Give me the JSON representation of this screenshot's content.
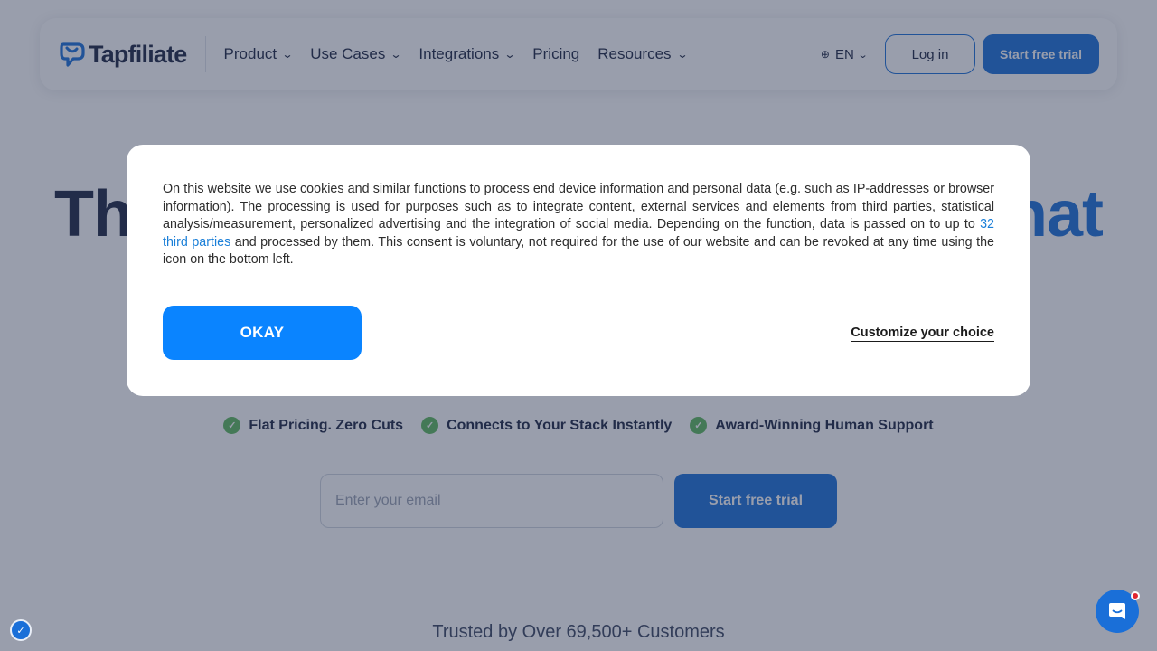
{
  "brand": {
    "name": "Tapfiliate",
    "accent": "#1a6fd8"
  },
  "nav": {
    "items": [
      {
        "label": "Product",
        "has_dropdown": true
      },
      {
        "label": "Use Cases",
        "has_dropdown": true
      },
      {
        "label": "Integrations",
        "has_dropdown": true
      },
      {
        "label": "Pricing",
        "has_dropdown": false
      },
      {
        "label": "Resources",
        "has_dropdown": true
      }
    ],
    "language": "EN",
    "login_label": "Log in",
    "trial_label": "Start free trial"
  },
  "hero": {
    "title_start": "Th",
    "title_end": "hat",
    "features": [
      "Flat Pricing. Zero Cuts",
      "Connects to Your Stack Instantly",
      "Award-Winning Human Support"
    ],
    "email_placeholder": "Enter your email",
    "cta_label": "Start free trial",
    "trusted_text": "Trusted by Over 69,500+ Customers"
  },
  "cookie_modal": {
    "text_before": "On this website we use cookies and similar functions to process end device information and personal data (e.g. such as IP-addresses or browser information). The processing is used for purposes such as to integrate content, external services and elements from third parties, statistical analysis/measurement, personalized advertising and the integration of social media. Depending on the function, data is passed on to up to ",
    "link_text": "32 third parties",
    "text_after": " and processed by them. This consent is voluntary, not required for the use of our website and can be revoked at any time using the icon on the bottom left.",
    "okay_label": "OKAY",
    "customize_label": "Customize your choice"
  },
  "icons": {
    "chevron": "chevron-down-icon",
    "globe": "globe-icon",
    "check": "check-circle-icon",
    "chat": "chat-icon",
    "consent": "consent-settings-icon"
  }
}
